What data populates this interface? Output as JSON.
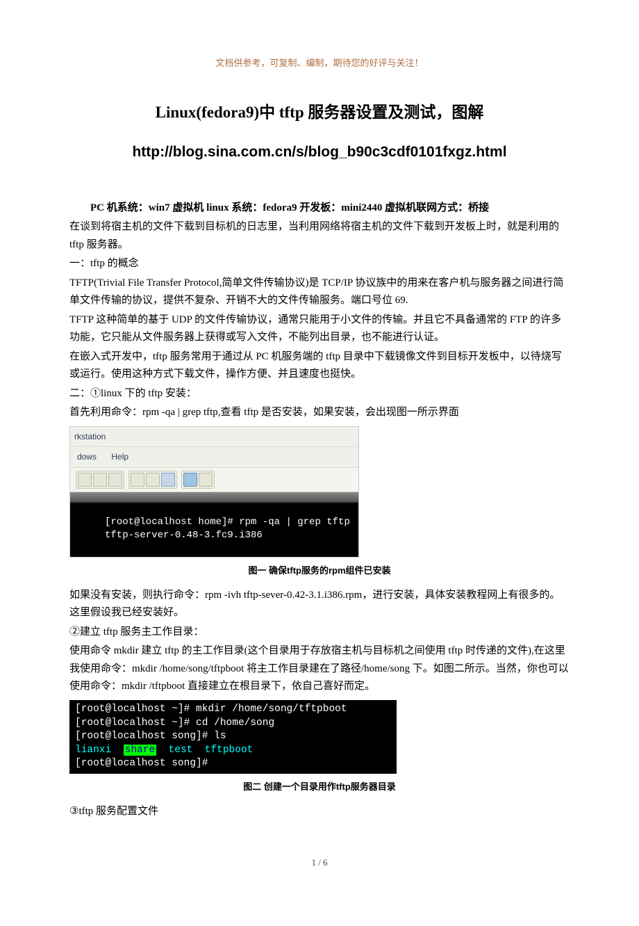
{
  "header_note": "文档供参考，可复制、编制，期待您的好评与关注！",
  "title": "Linux(fedora9)中 tftp 服务器设置及测试，图解",
  "subtitle": "http://blog.sina.com.cn/s/blog_b90c3cdf0101fxgz.html",
  "intro_bold": "PC 机系统：win7  虚拟机 linux 系统：fedora9  开发板：mini2440  虚拟机联网方式：桥接",
  "p1": "在谈到将宿主机的文件下载到目标机的日志里，当利用网络将宿主机的文件下载到开发板上时，就是利用的 tftp 服务器。",
  "h1": "一：tftp 的概念",
  "p2": "TFTP(Trivial File Transfer Protocol,简单文件传输协议)是 TCP/IP 协议族中的用来在客户机与服务器之间进行简单文件传输的协议，提供不复杂、开销不大的文件传输服务。端口号位 69.",
  "p3": "TFTP 这种简单的基于 UDP 的文件传输协议，通常只能用于小文件的传输。并且它不具备通常的 FTP 的许多功能，它只能从文件服务器上获得或写入文件，不能列出目录，也不能进行认证。",
  "p4": "在嵌入式开发中，tftp 服务常用于通过从 PC 机服务端的 tftp 目录中下载镜像文件到目标开发板中，以待烧写或运行。使用这种方式下载文件，操作方便、并且速度也挺快。",
  "h2": "二：①linux 下的 tftp 安装：",
  "p5": "首先利用命令：rpm -qa | grep tftp,查看 tftp 是否安装，如果安装，会出现图一所示界面",
  "fig1": {
    "rk_label": "rkstation",
    "menu_dows": "dows",
    "menu_help": "Help",
    "term_line1": "[root@localhost home]# rpm -qa | grep tftp",
    "term_line2": "tftp-server-0.48-3.fc9.i386",
    "caption": "图一      确保tftp服务的rpm组件已安装"
  },
  "p6": "如果没有安装，则执行命令：rpm -ivh tftp-sever-0.42-3.1.i386.rpm，进行安装，具体安装教程网上有很多的。这里假设我已经安装好。",
  "h3": "②建立 tftp 服务主工作目录：",
  "p7": "使用命令 mkdir 建立 tftp 的主工作目录(这个目录用于存放宿主机与目标机之间使用 tftp 时传递的文件),在这里我使用命令：mkdir /home/song/tftpboot 将主工作目录建在了路径/home/song 下。如图二所示。当然，你也可以使用命令：mkdir /tftpboot 直接建立在根目录下，依自己喜好而定。",
  "fig2": {
    "l1": "[root@localhost ~]# mkdir /home/song/tftpboot",
    "l2": "[root@localhost ~]# cd /home/song",
    "l3": "[root@localhost song]# ls",
    "l4a": "lianxi  ",
    "l4b": "share",
    "l4c": "  test  tftpboot",
    "l5": "[root@localhost song]#",
    "caption": "图二    创建一个目录用作tftp服务器目录"
  },
  "h4": "③tftp 服务配置文件",
  "footer": "1 / 6"
}
